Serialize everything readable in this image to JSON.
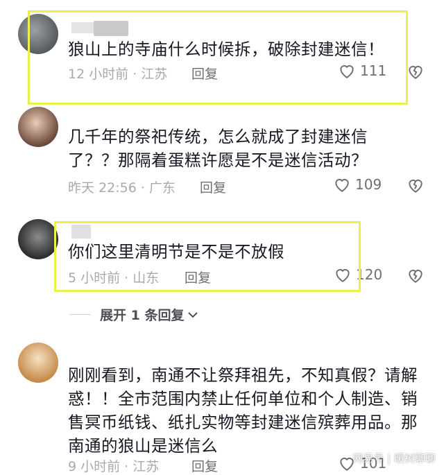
{
  "comments": [
    {
      "text": "狼山上的寺庙什么时候拆，破除封建迷信！",
      "time": "12 小时前 · 江苏",
      "reply": "回复",
      "likes": "111"
    },
    {
      "text": "几千年的祭祀传统，怎么就成了封建迷信了？？那隔着蛋糕许愿是不是迷信活动？",
      "time": "昨天 22:56 · 广东",
      "reply": "回复",
      "likes": "109"
    },
    {
      "text": "你们这里清明节是不是不放假",
      "time": "5 小时前 · 山东",
      "reply": "回复",
      "likes": "120"
    },
    {
      "text": "刚刚看到，南通不让祭拜祖先，不知真假？请解惑！！全市范围内禁止任何单位和个人制造、销售冥币纸钱、纸扎实物等封建迷信殡葬用品。那南通的狼山是迷信么",
      "time": "9 小时前 · 江苏",
      "reply": "回复",
      "likes": "101"
    }
  ],
  "expand_replies": "展开 1 条回复",
  "watermark": "网易号 | 暖树聊聊",
  "colors": {
    "highlight": "#eef04a",
    "meta": "#a8a9ae"
  }
}
